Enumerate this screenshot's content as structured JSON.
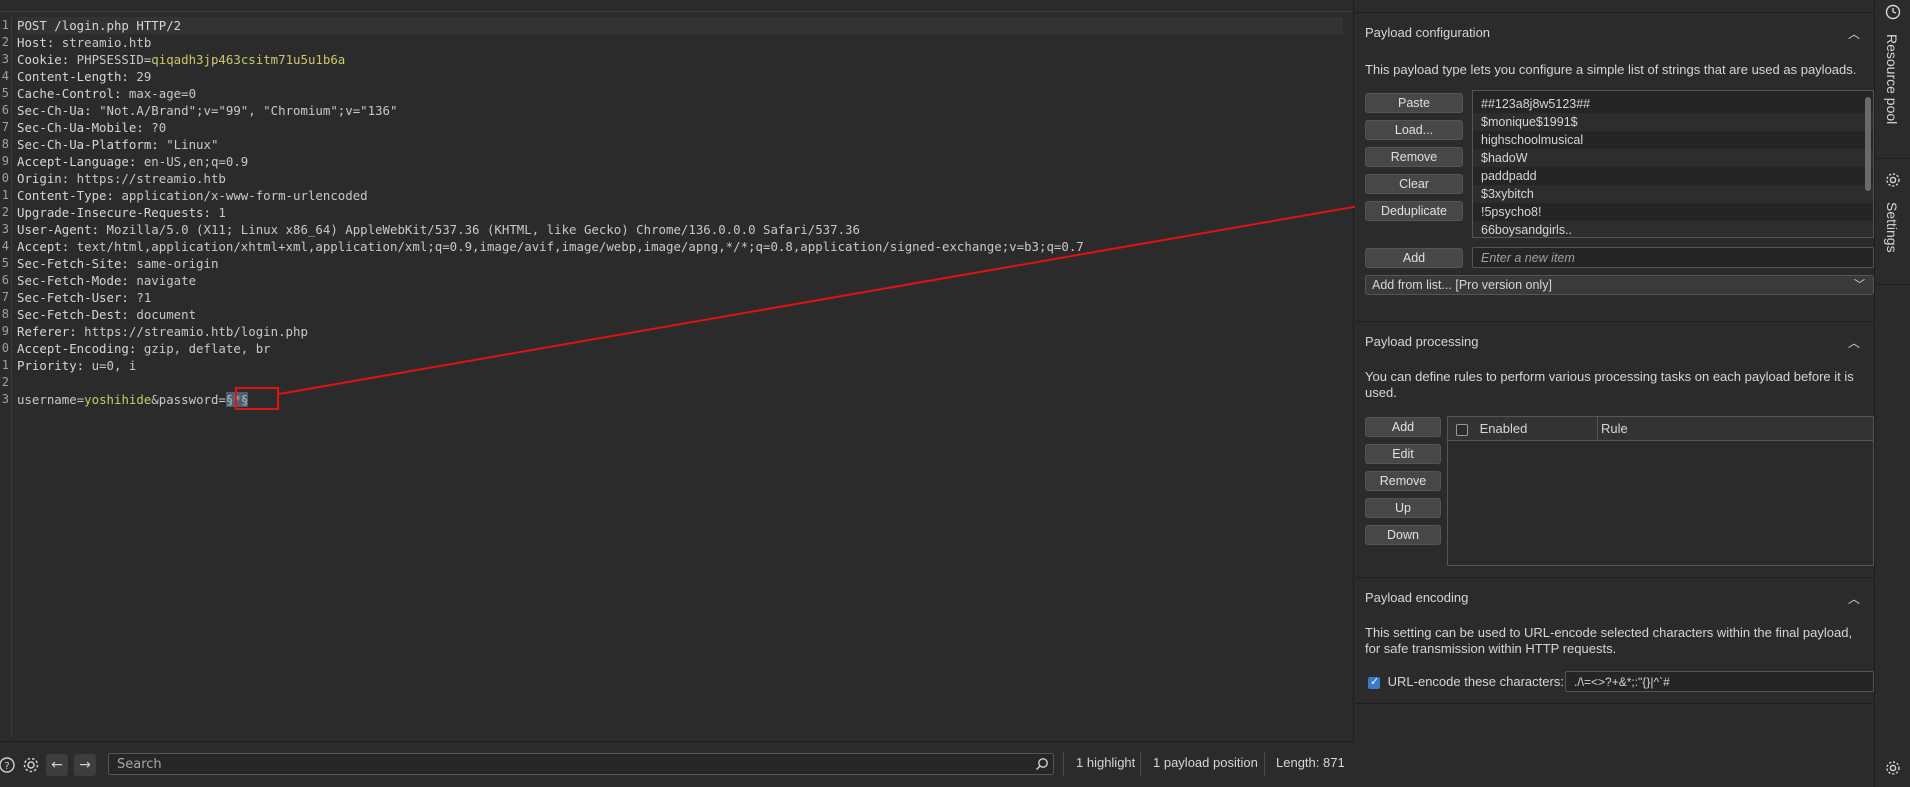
{
  "request": {
    "line_numbers": [
      "1",
      "2",
      "3",
      "4",
      "5",
      "6",
      "7",
      "8",
      "9",
      "0",
      "1",
      "2",
      "3",
      "4",
      "5",
      "6",
      "7",
      "8",
      "9",
      "0",
      "1",
      "2",
      "3"
    ],
    "lines": {
      "l1": "POST /login.php HTTP/2",
      "l2_name": "Host:",
      "l2_val": " streamio.htb",
      "l3_name": "Cookie:",
      "l3_cname": " PHPSESSID",
      "l3_eq": "=",
      "l3_cval": "qiqadh3jp463csitm71u5u1b6a",
      "l4_name": "Content-Length:",
      "l4_val": " 29",
      "l5_name": "Cache-Control:",
      "l5_val": " max-age=0",
      "l6_name": "Sec-Ch-Ua:",
      "l6_val": " \"Not.A/Brand\";v=\"99\", \"Chromium\";v=\"136\"",
      "l7_name": "Sec-Ch-Ua-Mobile:",
      "l7_val": " ?0",
      "l8_name": "Sec-Ch-Ua-Platform:",
      "l8_val": " \"Linux\"",
      "l9_name": "Accept-Language:",
      "l9_val": " en-US,en;q=0.9",
      "l10_name": "Origin:",
      "l10_val": " https://streamio.htb",
      "l11_name": "Content-Type:",
      "l11_val": " application/x-www-form-urlencoded",
      "l12_name": "Upgrade-Insecure-Requests:",
      "l12_val": " 1",
      "l13_name": "User-Agent:",
      "l13_val": " Mozilla/5.0 (X11; Linux x86_64) AppleWebKit/537.36 (KHTML, like Gecko) Chrome/136.0.0.0 Safari/537.36",
      "l14_name": "Accept:",
      "l14_val": " text/html,application/xhtml+xml,application/xml;q=0.9,image/avif,image/webp,image/apng,*/*;q=0.8,application/signed-exchange;v=b3;q=0.7",
      "l15_name": "Sec-Fetch-Site:",
      "l15_val": " same-origin",
      "l16_name": "Sec-Fetch-Mode:",
      "l16_val": " navigate",
      "l17_name": "Sec-Fetch-User:",
      "l17_val": " ?1",
      "l18_name": "Sec-Fetch-Dest:",
      "l18_val": " document",
      "l19_name": "Referer:",
      "l19_val": " https://streamio.htb/login.php",
      "l20_name": "Accept-Encoding:",
      "l20_val": " gzip, deflate, br",
      "l21_name": "Priority:",
      "l21_val": " u=0, i",
      "l23_p1": "username",
      "l23_eq1": "=",
      "l23_v1": "yoshihide",
      "l23_amp": "&",
      "l23_p2": "password",
      "l23_eq2": "=",
      "l23_marker": "§*§"
    }
  },
  "bottombar": {
    "search_placeholder": "Search",
    "highlight_count": "1 highlight",
    "payload_positions": "1 payload position",
    "length": "Length: 871"
  },
  "payload_configuration": {
    "title": "Payload configuration",
    "description": "This payload type lets you configure a simple list of strings that are used as payloads.",
    "buttons": {
      "paste": "Paste",
      "load": "Load...",
      "remove": "Remove",
      "clear": "Clear",
      "deduplicate": "Deduplicate",
      "add": "Add"
    },
    "items": [
      "##123a8j8w5123##",
      "$monique$1991$",
      "highschoolmusical",
      "$hadoW",
      "paddpadd",
      "$3xybitch",
      "!5psycho8!",
      "66boysandgirls.."
    ],
    "new_item_placeholder": "Enter a new item",
    "add_from_list": "Add from list... [Pro version only]"
  },
  "payload_processing": {
    "title": "Payload processing",
    "description": "You can define rules to perform various processing tasks on each payload before it is used.",
    "buttons": {
      "add": "Add",
      "edit": "Edit",
      "remove": "Remove",
      "up": "Up",
      "down": "Down"
    },
    "col_enabled": "Enabled",
    "col_rule": "Rule"
  },
  "payload_encoding": {
    "title": "Payload encoding",
    "description": "This setting can be used to URL-encode selected characters within the final payload, for safe transmission within HTTP requests.",
    "checkbox_label": "URL-encode these characters:",
    "checked": true,
    "chars": "./\\=<>?+&*;:\"{}|^`#"
  },
  "side_strip": {
    "resource_pool": "Resource pool",
    "settings": "Settings"
  },
  "colors": {
    "annotation": "#e01212",
    "cookie_value": "#c9c96a",
    "accent": "#3d77c8"
  }
}
